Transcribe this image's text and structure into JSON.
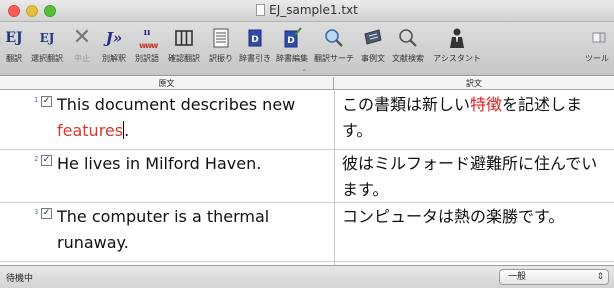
{
  "window": {
    "title": "EJ_sample1.txt"
  },
  "toolbar": {
    "buttons": [
      {
        "label": "翻訳",
        "icon": "ej-translate-icon",
        "disabled": false
      },
      {
        "label": "選択翻訳",
        "icon": "ej-selection-translate-icon",
        "disabled": false
      },
      {
        "label": "中止",
        "icon": "stop-x-icon",
        "disabled": true
      },
      {
        "label": "別解釈",
        "icon": "alternate-interpretation-icon",
        "disabled": false
      },
      {
        "label": "別訳語",
        "icon": "alternate-word-icon",
        "disabled": false
      },
      {
        "label": "確認翻訳",
        "icon": "confirm-translate-icon",
        "disabled": false
      },
      {
        "label": "訳振り",
        "icon": "interlinear-icon",
        "disabled": false
      },
      {
        "label": "辞書引き",
        "icon": "dictionary-lookup-icon",
        "disabled": false
      },
      {
        "label": "辞書編集",
        "icon": "dictionary-edit-icon",
        "disabled": false
      },
      {
        "label": "翻訳サーチ",
        "icon": "translation-search-icon",
        "disabled": false
      },
      {
        "label": "事例文",
        "icon": "example-sentence-icon",
        "disabled": false
      },
      {
        "label": "文献検索",
        "icon": "literature-search-icon",
        "disabled": false
      },
      {
        "label": "アシスタント",
        "icon": "assistant-icon",
        "disabled": false
      },
      {
        "label": "ツール",
        "icon": "tools-icon",
        "disabled": false
      }
    ]
  },
  "columns": {
    "source": "原文",
    "target": "訳文"
  },
  "rows": [
    {
      "num": "1",
      "checked": true,
      "source_before": "This document describes new ",
      "source_highlight": "features",
      "source_after": ".",
      "target_before": "この書類は新しい",
      "target_highlight": "特徴",
      "target_after": "を記述します。"
    },
    {
      "num": "2",
      "checked": true,
      "source_text": "He lives in Milford Haven.",
      "target_text": "彼はミルフォード避難所に住んでいます。"
    },
    {
      "num": "3",
      "checked": true,
      "source_text": "The computer is a thermal runaway.",
      "target_text": "コンピュータは熱の楽勝です。"
    }
  ],
  "status": {
    "text": "待機中",
    "category_select": "一般"
  },
  "colors": {
    "highlight_source": "#d9382b",
    "highlight_target": "#e02020",
    "row_number": "#5a7db5"
  }
}
